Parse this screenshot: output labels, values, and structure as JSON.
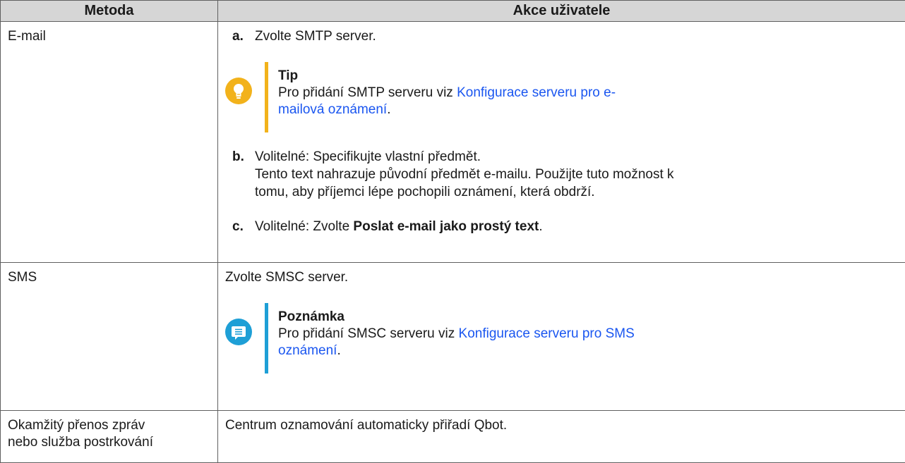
{
  "headers": {
    "method": "Metoda",
    "action": "Akce uživatele"
  },
  "email": {
    "method": "E-mail",
    "step_a": {
      "label": "a.",
      "text": "Zvolte SMTP server."
    },
    "tip": {
      "title": "Tip",
      "text_before": "Pro přidání SMTP serveru viz ",
      "link_line1": "Konfigurace serveru pro e-",
      "link_line2": "mailová oznámení",
      "text_after": "."
    },
    "step_b": {
      "label": "b.",
      "line1": "Volitelné: Specifikujte vlastní předmět.",
      "line2": "Tento text nahrazuje původní předmět e-mailu. Použijte tuto možnost k",
      "line3": "tomu, aby příjemci lépe pochopili oznámení, která obdrží."
    },
    "step_c": {
      "label": "c.",
      "text_before": "Volitelné: Zvolte ",
      "bold": "Poslat e-mail jako prostý text",
      "text_after": "."
    }
  },
  "sms": {
    "method": "SMS",
    "text": "Zvolte SMSC server.",
    "note": {
      "title": "Poznámka",
      "text_before": "Pro přidání SMSC serveru viz ",
      "link_line1": "Konfigurace serveru pro SMS",
      "link_line2": "oznámení",
      "text_after": "."
    }
  },
  "im": {
    "method_line1": "Okamžitý přenos zpráv",
    "method_line2": "nebo služba postrkování",
    "text": "Centrum oznamování automaticky přiřadí Qbot."
  },
  "colors": {
    "tip": "#f2b21b",
    "note": "#1e9fd6",
    "link": "#1a56f0",
    "header_bg": "#d6d6d6"
  },
  "icons": {
    "tip": "lightbulb-icon",
    "note": "message-icon"
  }
}
